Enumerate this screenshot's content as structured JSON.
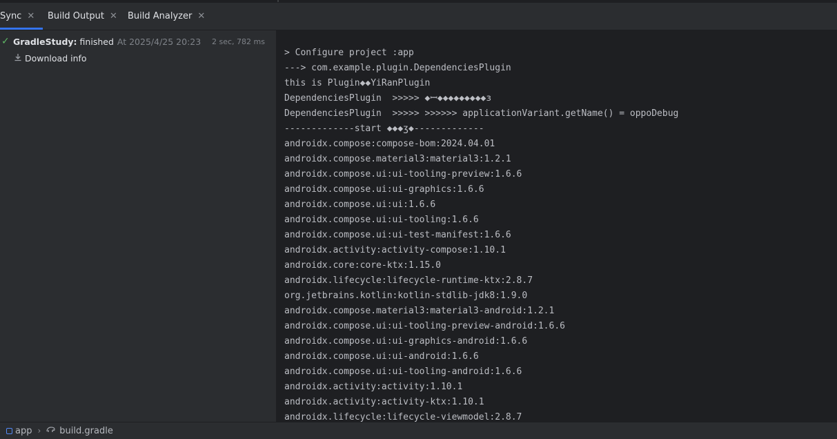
{
  "tabs": [
    {
      "label": "Sync",
      "active": true
    },
    {
      "label": "Build Output",
      "active": false
    },
    {
      "label": "Build Analyzer",
      "active": false
    }
  ],
  "tree": {
    "root": {
      "project": "GradleStudy:",
      "status": "finished",
      "time": "At 2025/4/25 20:23",
      "duration": "2 sec, 782 ms"
    },
    "child": {
      "label": "Download info"
    }
  },
  "console_lines": [
    "> Configure project :app",
    "---> com.example.plugin.DependenciesPlugin",
    "this is Plugin◆◆YiRanPlugin",
    "DependenciesPlugin  >>>>> ◆ꟷ◆◆◆◆◆◆◆◆◆ɜ",
    "DependenciesPlugin  >>>>> >>>>>> applicationVariant.getName() = oppoDebug",
    "-------------start ◆◆◆ʒ◆-------------",
    "androidx.compose:compose-bom:2024.04.01",
    "androidx.compose.material3:material3:1.2.1",
    "androidx.compose.ui:ui-tooling-preview:1.6.6",
    "androidx.compose.ui:ui-graphics:1.6.6",
    "androidx.compose.ui:ui:1.6.6",
    "androidx.compose.ui:ui-tooling:1.6.6",
    "androidx.compose.ui:ui-test-manifest:1.6.6",
    "androidx.activity:activity-compose:1.10.1",
    "androidx.core:core-ktx:1.15.0",
    "androidx.lifecycle:lifecycle-runtime-ktx:2.8.7",
    "org.jetbrains.kotlin:kotlin-stdlib-jdk8:1.9.0",
    "androidx.compose.material3:material3-android:1.2.1",
    "androidx.compose.ui:ui-tooling-preview-android:1.6.6",
    "androidx.compose.ui:ui-graphics-android:1.6.6",
    "androidx.compose.ui:ui-android:1.6.6",
    "androidx.compose.ui:ui-tooling-android:1.6.6",
    "androidx.activity:activity:1.10.1",
    "androidx.activity:activity-ktx:1.10.1",
    "androidx.lifecycle:lifecycle-viewmodel:2.8.7"
  ],
  "statusbar": {
    "module": "app",
    "file": "build.gradle"
  },
  "colors": {
    "accent": "#3574f0",
    "success": "#5fb865",
    "panel": "#2b2d30",
    "editor": "#1e1f22"
  }
}
